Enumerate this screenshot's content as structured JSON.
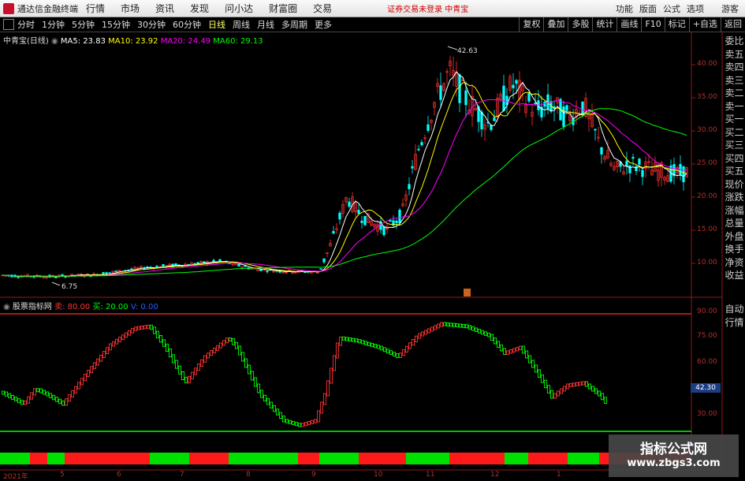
{
  "menubar": {
    "app_title": "通达信金融终端",
    "items": [
      "行情",
      "市场",
      "资讯",
      "发现",
      "问小达",
      "财富圈",
      "交易"
    ],
    "announcement": "证券交易未登录  中青宝",
    "right_items": [
      "功能",
      "版面",
      "公式",
      "选项"
    ],
    "guest": "游客"
  },
  "toolbar": {
    "periods": [
      "分时",
      "1分钟",
      "5分钟",
      "15分钟",
      "30分钟",
      "60分钟",
      "日线",
      "周线",
      "月线",
      "多周期",
      "更多"
    ],
    "active_period": "日线",
    "right_items": [
      "复权",
      "叠加",
      "多股",
      "统计",
      "画线",
      "F10",
      "标记",
      "+自选",
      "返回"
    ]
  },
  "main_chart": {
    "stock": "中青宝(日线)",
    "ma5": "MA5: 23.83",
    "ma10": "MA10: 23.92",
    "ma20": "MA20: 24.49",
    "ma60": "MA60: 29.13",
    "high_label": "42.63",
    "low_label": "6.75",
    "y_ticks": [
      "40.00",
      "35.00",
      "30.00",
      "25.00",
      "20.00",
      "15.00",
      "10.00"
    ],
    "colors": {
      "up": "#ff3232",
      "down": "#00ffff",
      "ma5": "#ffffff",
      "ma10": "#ffff00",
      "ma20": "#ff00ff",
      "ma60": "#00ff00"
    }
  },
  "sub_chart": {
    "name": "股票指标网",
    "sell": "卖: 80.00",
    "buy": "买: 20.00",
    "v": "V: 0.00",
    "y_ticks": [
      "90.00",
      "75.00",
      "60.00",
      "30.00"
    ],
    "current_value": "42.30",
    "colors": {
      "rise": "#ff3232",
      "fall": "#00ff00"
    }
  },
  "x_axis": [
    "2021年",
    "5",
    "6",
    "7",
    "8",
    "9",
    "10",
    "11",
    "12",
    "1"
  ],
  "side_panel": [
    "委比",
    "卖五",
    "卖四",
    "卖三",
    "卖二",
    "卖一",
    "买一",
    "买二",
    "买三",
    "买四",
    "买五",
    "现价",
    "涨跌",
    "涨幅",
    "总量",
    "外盘",
    "换手",
    "净资",
    "收益"
  ],
  "side_panel2": [
    "自动",
    "行情"
  ],
  "watermark": {
    "title": "指标公式网",
    "url": "www.zbgs3.com"
  }
}
